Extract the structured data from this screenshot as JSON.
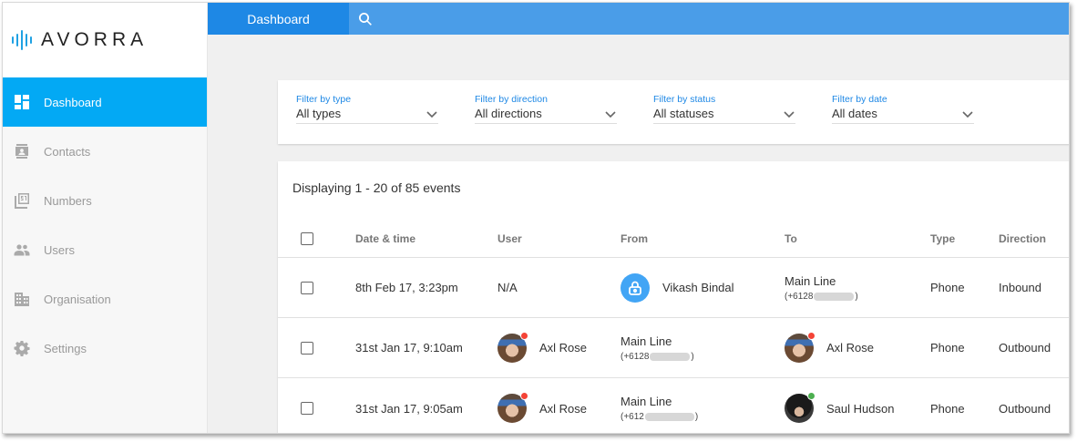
{
  "brand": {
    "name": "AVORRA"
  },
  "colors": {
    "accent": "#03a9f4",
    "header": "#4a9de8",
    "header_tab": "#1e88e5",
    "online": "#4caf50",
    "busy": "#f44336"
  },
  "sidebar": {
    "items": [
      {
        "label": "Dashboard",
        "icon": "dashboard-icon",
        "active": true
      },
      {
        "label": "Contacts",
        "icon": "contact-card-icon"
      },
      {
        "label": "Numbers",
        "icon": "numbers-icon"
      },
      {
        "label": "Users",
        "icon": "users-icon"
      },
      {
        "label": "Organisation",
        "icon": "building-icon"
      },
      {
        "label": "Settings",
        "icon": "gear-icon"
      }
    ]
  },
  "header": {
    "tab": "Dashboard",
    "search_icon": "search-icon"
  },
  "filters": [
    {
      "label": "Filter by type",
      "value": "All types"
    },
    {
      "label": "Filter by direction",
      "value": "All directions"
    },
    {
      "label": "Filter by status",
      "value": "All statuses"
    },
    {
      "label": "Filter by date",
      "value": "All dates"
    }
  ],
  "events": {
    "summary": "Displaying 1 - 20 of 85 events",
    "columns": [
      "Date & time",
      "User",
      "From",
      "To",
      "Type",
      "Direction"
    ],
    "rows": [
      {
        "datetime": "8th Feb 17, 3:23pm",
        "user": "N/A",
        "from": "Vikash Bindal",
        "to": "Main Line",
        "to_number": "(+6128",
        "to_number_end": ")",
        "type": "Phone",
        "direction": "Inbound"
      },
      {
        "datetime": "31st Jan 17, 9:10am",
        "user": "Axl Rose",
        "from": "Main Line",
        "from_number": "(+6128",
        "from_number_end": ")",
        "to": "Axl Rose",
        "type": "Phone",
        "direction": "Outbound"
      },
      {
        "datetime": "31st Jan 17, 9:05am",
        "user": "Axl Rose",
        "from": "Main Line",
        "from_number": "(+612",
        "from_number_end": ")",
        "to": "Saul Hudson",
        "type": "Phone",
        "direction": "Outbound"
      }
    ]
  }
}
